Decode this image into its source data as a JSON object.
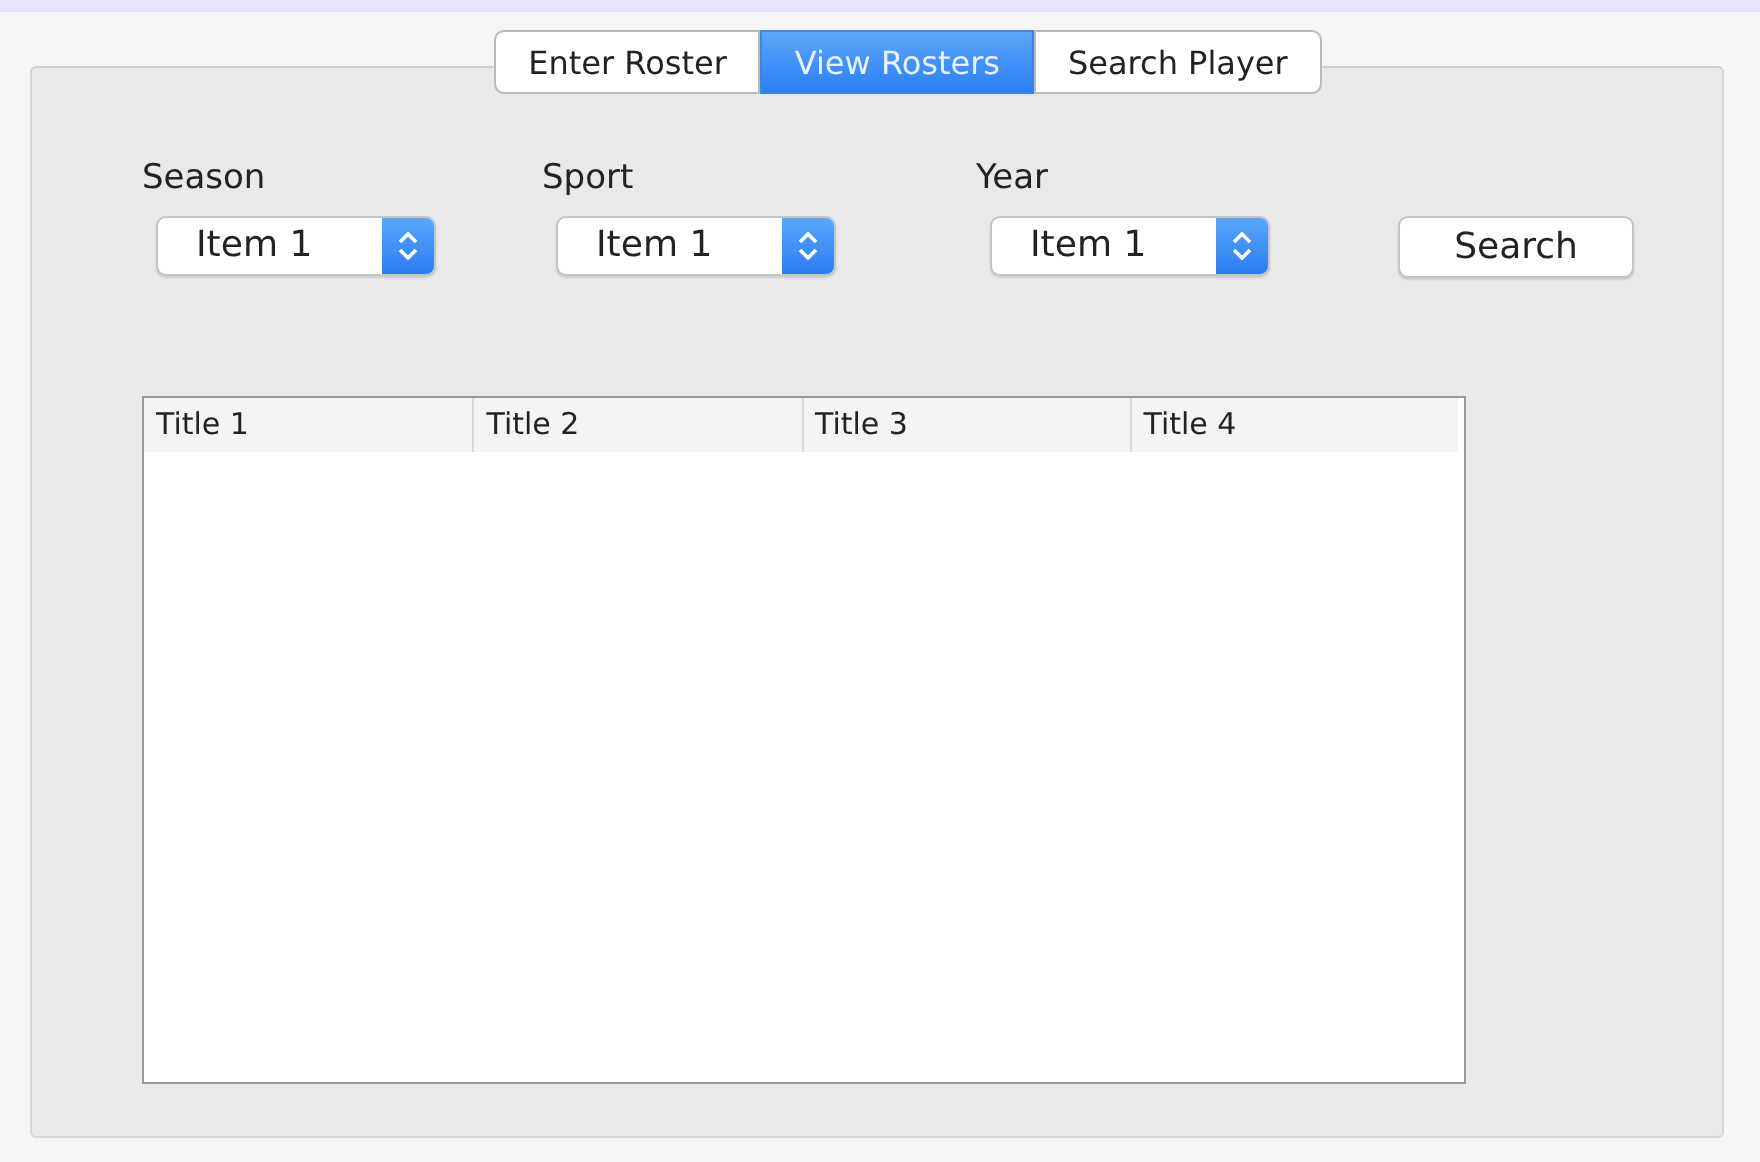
{
  "tabs": [
    {
      "label": "Enter Roster",
      "selected": false
    },
    {
      "label": "View Rosters",
      "selected": true
    },
    {
      "label": "Search Player",
      "selected": false
    }
  ],
  "filters": [
    {
      "label": "Season",
      "value": "Item 1"
    },
    {
      "label": "Sport",
      "value": "Item 1"
    },
    {
      "label": "Year",
      "value": "Item 1"
    }
  ],
  "search_button": "Search",
  "table": {
    "columns": [
      "Title 1",
      "Title 2",
      "Title 3",
      "Title 4"
    ]
  }
}
